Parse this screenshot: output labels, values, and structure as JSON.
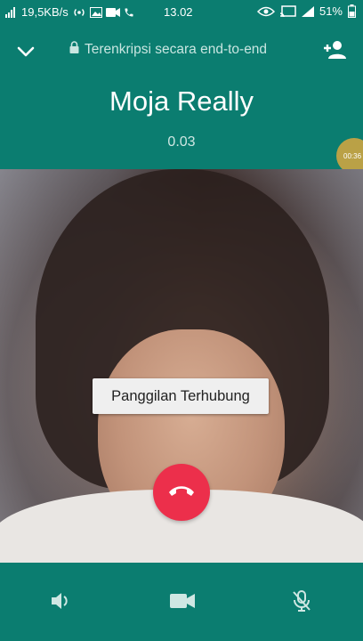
{
  "statusbar": {
    "network_speed": "19,5KB/s",
    "time": "13.02",
    "battery": "51%"
  },
  "header": {
    "encryption_text": "Terenkripsi secara end-to-end",
    "contact_name": "Moja Really",
    "call_timer": "0.03"
  },
  "overlay": {
    "toast_text": "Panggilan Terhubung",
    "floating_bubble_text": "00:36"
  },
  "icons": {
    "minimize": "chevron-down-icon",
    "lock": "lock-icon",
    "add_participant": "add-person-icon",
    "end_call": "phone-hangup-icon",
    "speaker": "speaker-icon",
    "video": "video-camera-icon",
    "mute": "mic-off-icon"
  },
  "colors": {
    "header_bg": "#0b7d70",
    "end_call": "#ec2f4b"
  }
}
